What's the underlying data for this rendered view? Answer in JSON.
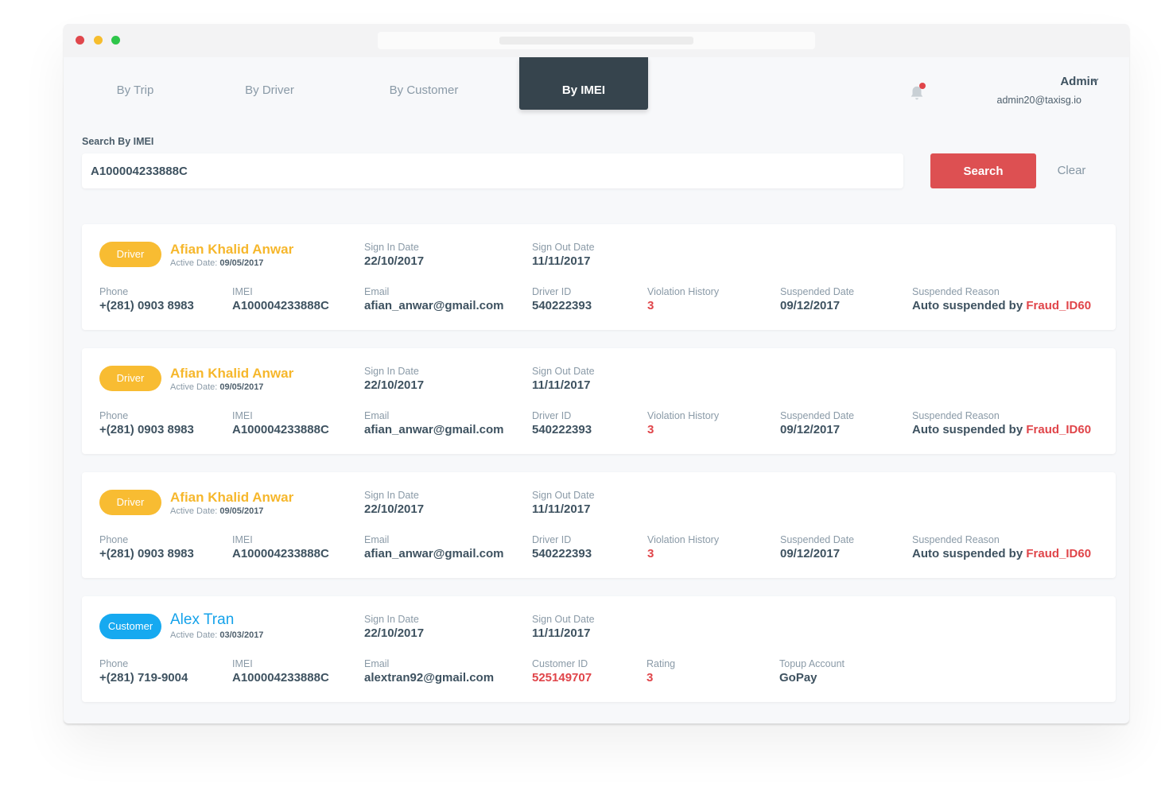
{
  "window": {
    "controls": [
      "close",
      "minimize",
      "maximize"
    ]
  },
  "tabs": [
    {
      "label": "By Trip",
      "active": false
    },
    {
      "label": "By Driver",
      "active": false
    },
    {
      "label": "By Customer",
      "active": false
    },
    {
      "label": "By IMEI",
      "active": true
    }
  ],
  "header": {
    "notification_icon": "bell-icon",
    "has_notification": true,
    "user_name": "Admin",
    "user_email": "admin20@taxisg.io",
    "dropdown_icon": "chevron-down-icon"
  },
  "search": {
    "label": "Search By IMEI",
    "value": "A100004233888C",
    "placeholder": "",
    "search_button": "Search",
    "clear_button": "Clear"
  },
  "colors": {
    "driver_badge": "#f8bc32",
    "customer_badge": "#16a9f0",
    "accent_red": "#dd5052",
    "active_tab": "#36444d"
  },
  "results": [
    {
      "type": "Driver",
      "name": "Afian Khalid Anwar",
      "active_date_label": "Active Date:",
      "active_date": "09/05/2017",
      "sign_in_label": "Sign In Date",
      "sign_in": "22/10/2017",
      "sign_out_label": "Sign Out Date",
      "sign_out": "11/11/2017",
      "phone_label": "Phone",
      "phone": "+(281) 0903 8983",
      "imei_label": "IMEI",
      "imei": "A100004233888C",
      "email_label": "Email",
      "email": "afian_anwar@gmail.com",
      "id_label": "Driver ID",
      "id": "540222393",
      "violation_label": "Violation History",
      "violation": "3",
      "suspended_date_label": "Suspended Date",
      "suspended_date": "09/12/2017",
      "suspended_reason_label": "Suspended Reason",
      "suspended_reason_prefix": "Auto suspended by",
      "suspended_reason_ref": "Fraud_ID60"
    },
    {
      "type": "Driver",
      "name": "Afian Khalid Anwar",
      "active_date_label": "Active Date:",
      "active_date": "09/05/2017",
      "sign_in_label": "Sign In Date",
      "sign_in": "22/10/2017",
      "sign_out_label": "Sign Out Date",
      "sign_out": "11/11/2017",
      "phone_label": "Phone",
      "phone": "+(281) 0903 8983",
      "imei_label": "IMEI",
      "imei": "A100004233888C",
      "email_label": "Email",
      "email": "afian_anwar@gmail.com",
      "id_label": "Driver ID",
      "id": "540222393",
      "violation_label": "Violation History",
      "violation": "3",
      "suspended_date_label": "Suspended Date",
      "suspended_date": "09/12/2017",
      "suspended_reason_label": "Suspended Reason",
      "suspended_reason_prefix": "Auto suspended by",
      "suspended_reason_ref": "Fraud_ID60"
    },
    {
      "type": "Driver",
      "name": "Afian Khalid Anwar",
      "active_date_label": "Active Date:",
      "active_date": "09/05/2017",
      "sign_in_label": "Sign In Date",
      "sign_in": "22/10/2017",
      "sign_out_label": "Sign Out Date",
      "sign_out": "11/11/2017",
      "phone_label": "Phone",
      "phone": "+(281) 0903 8983",
      "imei_label": "IMEI",
      "imei": "A100004233888C",
      "email_label": "Email",
      "email": "afian_anwar@gmail.com",
      "id_label": "Driver ID",
      "id": "540222393",
      "violation_label": "Violation History",
      "violation": "3",
      "suspended_date_label": "Suspended Date",
      "suspended_date": "09/12/2017",
      "suspended_reason_label": "Suspended Reason",
      "suspended_reason_prefix": "Auto suspended by",
      "suspended_reason_ref": "Fraud_ID60"
    },
    {
      "type": "Customer",
      "name": "Alex Tran",
      "active_date_label": "Active Date:",
      "active_date": "03/03/2017",
      "sign_in_label": "Sign In Date",
      "sign_in": "22/10/2017",
      "sign_out_label": "Sign Out Date",
      "sign_out": "11/11/2017",
      "phone_label": "Phone",
      "phone": "+(281) 719-9004",
      "imei_label": "IMEI",
      "imei": "A100004233888C",
      "email_label": "Email",
      "email": "alextran92@gmail.com",
      "id_label": "Customer ID",
      "id": "525149707",
      "rating_label": "Rating",
      "rating": "3",
      "topup_label": "Topup Account",
      "topup": "GoPay"
    }
  ]
}
